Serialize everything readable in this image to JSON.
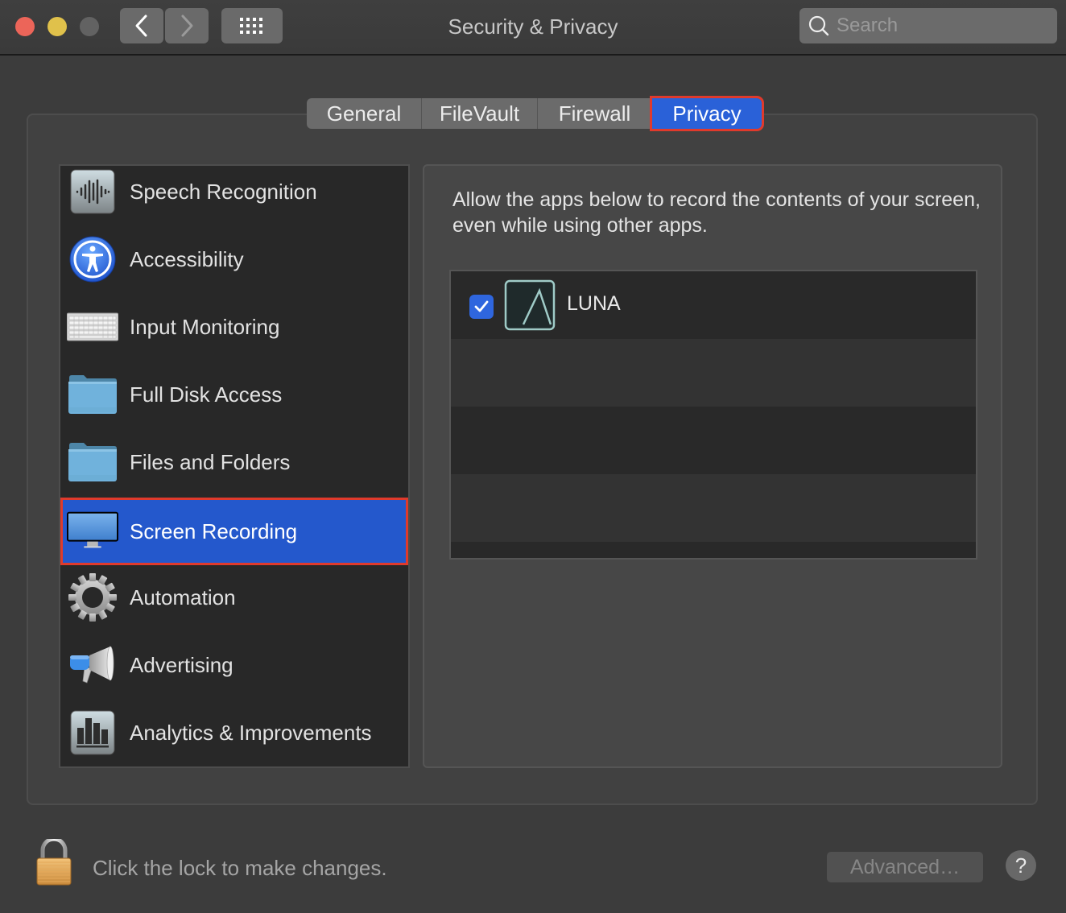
{
  "window": {
    "title": "Security & Privacy",
    "search_placeholder": "Search"
  },
  "tabs": [
    {
      "label": "General",
      "selected": false
    },
    {
      "label": "FileVault",
      "selected": false
    },
    {
      "label": "Firewall",
      "selected": false
    },
    {
      "label": "Privacy",
      "selected": true
    }
  ],
  "sidebar": {
    "items": [
      {
        "label": "Speech Recognition",
        "icon": "waveform-icon"
      },
      {
        "label": "Accessibility",
        "icon": "accessibility-icon"
      },
      {
        "label": "Input Monitoring",
        "icon": "keyboard-icon"
      },
      {
        "label": "Full Disk Access",
        "icon": "folder-icon"
      },
      {
        "label": "Files and Folders",
        "icon": "folder-icon"
      },
      {
        "label": "Screen Recording",
        "icon": "display-icon",
        "selected": true
      },
      {
        "label": "Automation",
        "icon": "gear-icon"
      },
      {
        "label": "Advertising",
        "icon": "megaphone-icon"
      },
      {
        "label": "Analytics & Improvements",
        "icon": "bar-chart-icon"
      }
    ]
  },
  "detail": {
    "description": "Allow the apps below to record the contents of your screen, even while using other apps.",
    "apps": [
      {
        "name": "LUNA",
        "checked": true
      }
    ]
  },
  "footer": {
    "lock_text": "Click the lock to make changes.",
    "advanced_label": "Advanced…",
    "help_label": "?"
  },
  "colors": {
    "selection_blue": "#2458cc",
    "highlight_red": "#e03a2c",
    "checkbox_blue": "#2f66de"
  }
}
